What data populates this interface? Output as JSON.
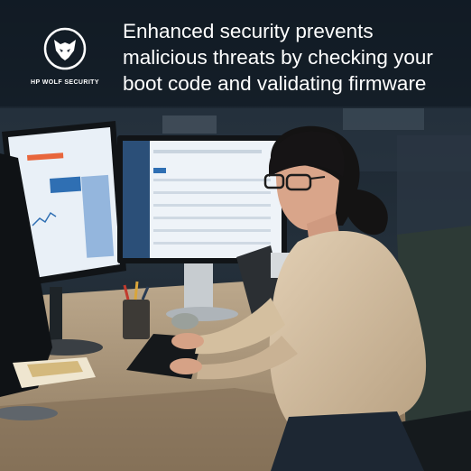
{
  "brand": {
    "logo_text": "HP WOLF SECURITY",
    "logo_icon": "wolf-icon"
  },
  "headline": {
    "line1": "Enhanced security prevents",
    "line2": "malicious threats by checking your",
    "line3": "boot code and validating firmware"
  },
  "colors": {
    "text": "#ffffff",
    "backdrop": "#1a2430",
    "monitor_screen": "#e9f0f7",
    "accent_blue": "#2f6fb3",
    "sweater": "#d8c3a6"
  }
}
